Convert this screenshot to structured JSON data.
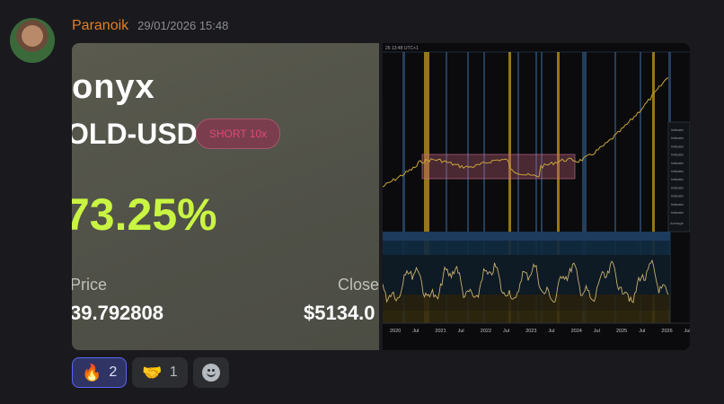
{
  "message": {
    "username": "Paranoik",
    "timestamp": "29/01/2026 15:48"
  },
  "trade_card": {
    "brand": "onyx",
    "pair": "OLD-USD",
    "position_badge": "SHORT 10x",
    "percent": "73.25%",
    "price_label": "Price",
    "price_value": "39.792808",
    "closed_label": "Closed",
    "closed_value": "$5134.0",
    "colors": {
      "percent": "#c9f542",
      "badge_text": "#e0487a"
    }
  },
  "chart_image": {
    "header_text": "26 13:48 UTC+1",
    "x_axis_labels": [
      "2020",
      "Jul",
      "2021",
      "Jul",
      "2022",
      "Jul",
      "2023",
      "Jul",
      "2024",
      "Jul",
      "2025",
      "Jul",
      "2026",
      "Jul"
    ],
    "legend_rows": [
      "Indicator",
      "Indicator",
      "Indicator",
      "Indicator",
      "Indicator",
      "Indicator",
      "Indicator",
      "Indicator",
      "Indicator",
      "Indicator",
      "Indicator"
    ],
    "legend_footer": "Average"
  },
  "reactions": [
    {
      "emoji": "🔥",
      "emoji_name": "fire-icon",
      "count": "2",
      "active": true
    },
    {
      "emoji": "🤝",
      "emoji_name": "handshake-icon",
      "count": "1",
      "active": false
    }
  ],
  "add_reaction_icon": "smiley-icon"
}
